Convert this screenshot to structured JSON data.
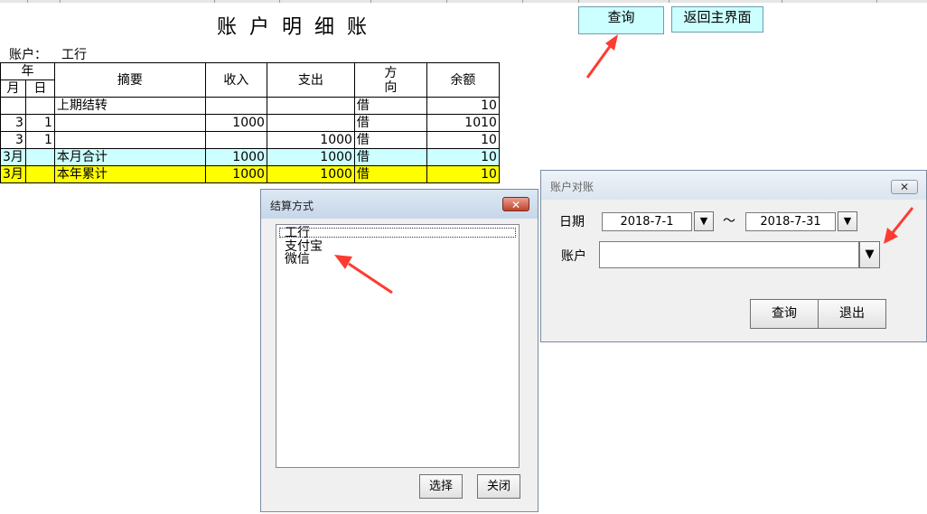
{
  "sheet": {
    "title": "账户明细账",
    "account_label": "账户：",
    "account_value": "工行",
    "headers": {
      "year": "年",
      "month": "月",
      "day": "日",
      "summary": "摘要",
      "income": "收入",
      "expense": "支出",
      "direction_top": "方",
      "direction_bottom": "向",
      "balance": "余额"
    },
    "rows": [
      {
        "month": "",
        "day": "",
        "summary": "上期结转",
        "income": "",
        "expense": "",
        "direction": "借",
        "balance": "10"
      },
      {
        "month": "3",
        "day": "1",
        "summary": "",
        "income": "1000",
        "expense": "",
        "direction": "借",
        "balance": "1010"
      },
      {
        "month": "3",
        "day": "1",
        "summary": "",
        "income": "",
        "expense": "1000",
        "direction": "借",
        "balance": "10"
      },
      {
        "month": "3月",
        "day": "",
        "summary": "本月合计",
        "income": "1000",
        "expense": "1000",
        "direction": "借",
        "balance": "10"
      },
      {
        "month": "3月",
        "day": "",
        "summary": "本年累计",
        "income": "1000",
        "expense": "1000",
        "direction": "借",
        "balance": "10"
      }
    ],
    "query_button": "查询",
    "return_button": "返回主界面"
  },
  "settlement_dialog": {
    "title": "结算方式",
    "close_glyph": "✕",
    "items": [
      "工行",
      "支付宝",
      "微信"
    ],
    "select_button": "选择",
    "close_button": "关闭"
  },
  "reconcile_dialog": {
    "title": "账户对账",
    "close_glyph": "✕",
    "date_label": "日期",
    "date_from": "2018-7-1",
    "tilde": "～",
    "date_to": "2018-7-31",
    "account_label": "账户",
    "account_value": "",
    "dropdown_glyph": "▼",
    "query_button": "查询",
    "exit_button": "退出"
  },
  "colors": {
    "month_total_row": "#ccffff",
    "year_total_row": "#ffff00",
    "sheet_button": "#ccffff",
    "annotation_arrow": "#ff3b30"
  }
}
